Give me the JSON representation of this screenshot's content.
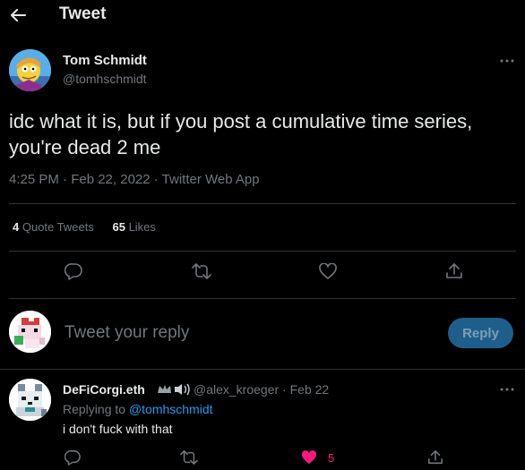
{
  "header": {
    "title": "Tweet",
    "back_icon": "arrow-left-icon"
  },
  "tweet": {
    "author_name": "Tom Schmidt",
    "author_handle": "@tomhschmidt",
    "text_line1": "idc what it is, but if you post a cumulative time series,",
    "text_line2": "you're dead 2 me",
    "timestamp": "4:25 PM · Feb 22, 2022 · Twitter Web App",
    "quote_count": "4",
    "quote_label": "Quote Tweets",
    "like_count": "65",
    "like_label": "Likes"
  },
  "actions": [
    "reply-icon",
    "retweet-icon",
    "like-icon",
    "share-icon"
  ],
  "composer": {
    "placeholder": "Tweet your reply",
    "button_label": "Reply"
  },
  "reply": {
    "author_name": "DeFiCorgi.eth",
    "author_handle": "@alex_kroeger",
    "separator": "·",
    "date": "Feb 22",
    "replying_prefix": "Replying to",
    "replying_handle": "@tomhschmidt",
    "text": "i don't fuck with that",
    "like_count": "5"
  },
  "colors": {
    "background": "#000000",
    "text_primary": "#e7e9ea",
    "text_secondary": "#71767b",
    "accent": "#1d9bf0",
    "like": "#f91880",
    "divider": "#2f3336"
  }
}
